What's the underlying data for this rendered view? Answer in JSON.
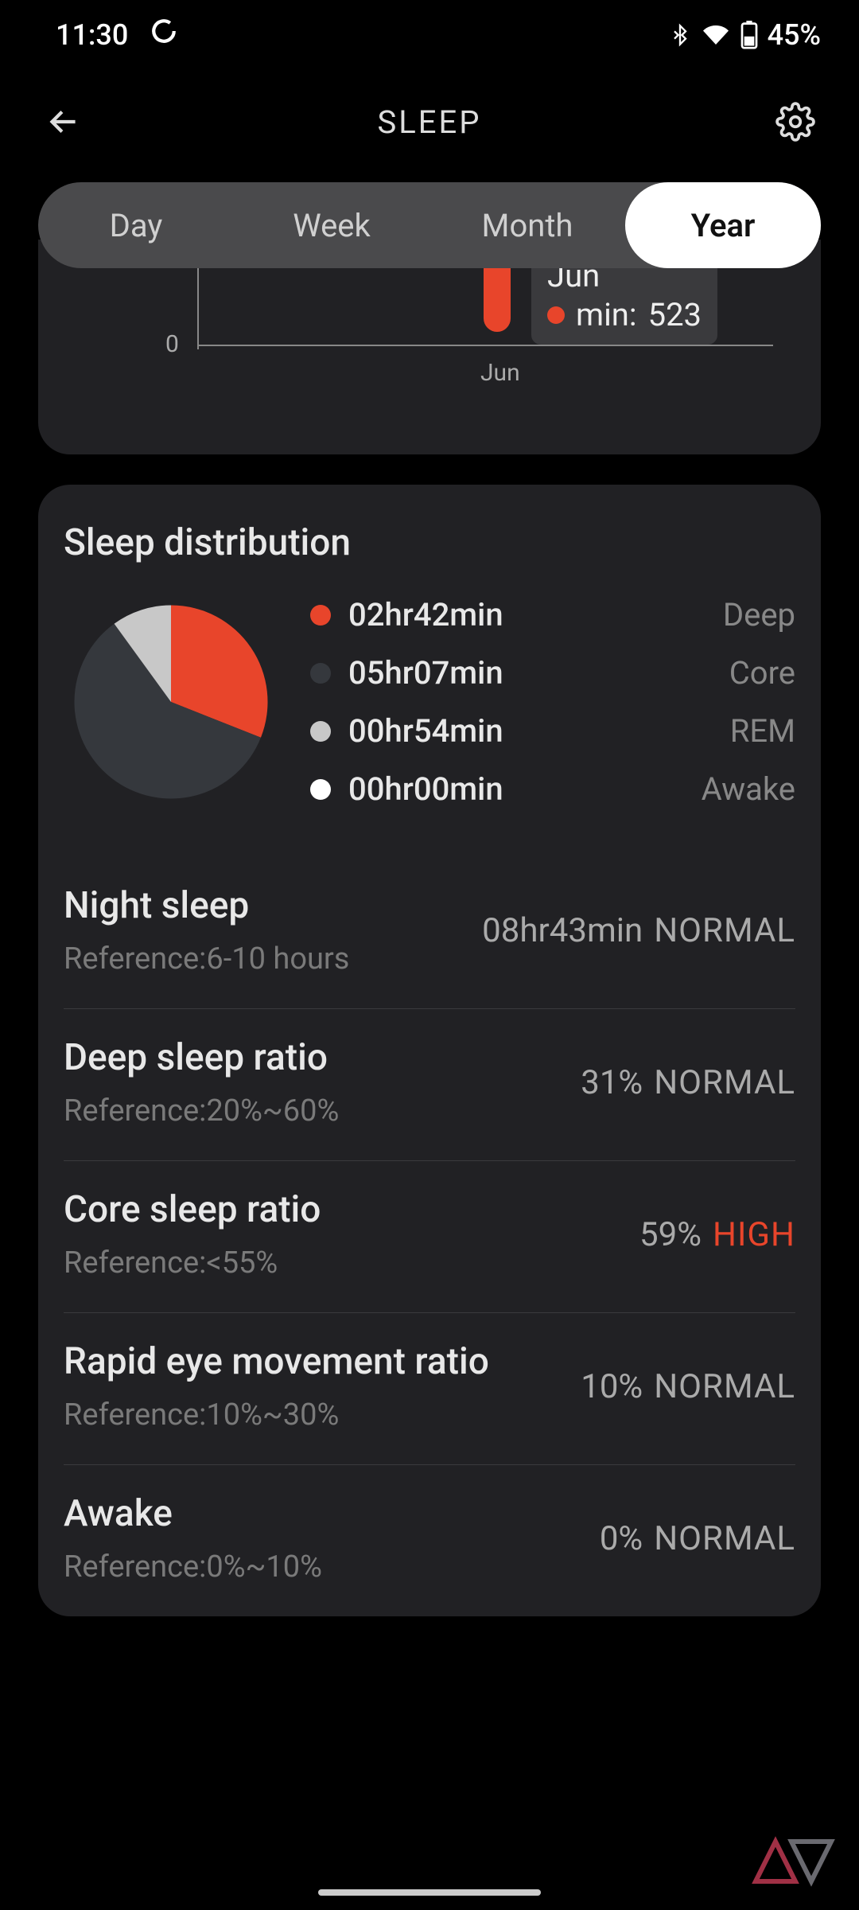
{
  "status": {
    "time": "11:30",
    "battery": "45%"
  },
  "header": {
    "title": "SLEEP"
  },
  "tabs": {
    "items": [
      "Day",
      "Week",
      "Month",
      "Year"
    ],
    "active": 3
  },
  "chart_data": {
    "type": "bar",
    "categories": [
      "Jun"
    ],
    "values": [
      523
    ],
    "ylabel": "min",
    "ylim": [
      0,
      600
    ],
    "y_tick_shown": "0",
    "x_tick_shown": "Jun",
    "tooltip": {
      "title": "Jun",
      "label": "min:",
      "value": "523"
    }
  },
  "distribution": {
    "title": "Sleep distribution",
    "slices": [
      {
        "label": "Deep",
        "time": "02hr42min",
        "color": "#e8452b",
        "percent": 31
      },
      {
        "label": "Core",
        "time": "05hr07min",
        "color": "#35383d",
        "percent": 59
      },
      {
        "label": "REM",
        "time": "00hr54min",
        "color": "#c8c8c8",
        "percent": 10
      },
      {
        "label": "Awake",
        "time": "00hr00min",
        "color": "#ffffff",
        "percent": 0
      }
    ]
  },
  "metrics": [
    {
      "name": "Night sleep",
      "reference": "Reference:6-10 hours",
      "value": "08hr43min",
      "status": "NORMAL",
      "level": "normal"
    },
    {
      "name": "Deep sleep ratio",
      "reference": "Reference:20%~60%",
      "value": "31%",
      "status": "NORMAL",
      "level": "normal"
    },
    {
      "name": "Core sleep ratio",
      "reference": "Reference:<55%",
      "value": "59%",
      "status": "HIGH",
      "level": "high"
    },
    {
      "name": "Rapid eye movement ratio",
      "reference": "Reference:10%~30%",
      "value": "10%",
      "status": "NORMAL",
      "level": "normal"
    },
    {
      "name": "Awake",
      "reference": "Reference:0%~10%",
      "value": "0%",
      "status": "NORMAL",
      "level": "normal"
    }
  ]
}
